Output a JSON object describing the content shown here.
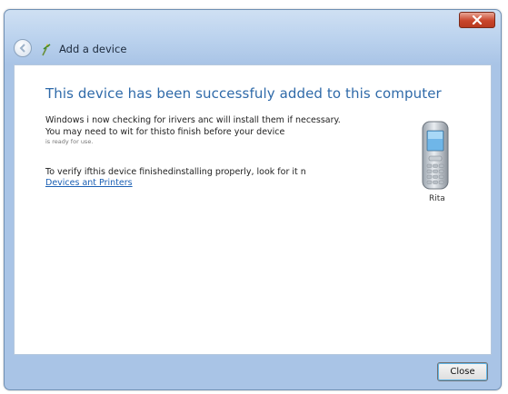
{
  "window": {
    "title": "Add a device"
  },
  "content": {
    "heading": "This device has been successfuly added to this computer",
    "message": "Windows i now checking for irivers anc will install them if necessary. You may need to wit for thisto finish before your device",
    "message_small": "is ready for use.",
    "verify_text": "To verify ifthis device finishedinstalling properly, look for it n",
    "link_text": "Devices ant Printers",
    "device_label": "Rita"
  },
  "footer": {
    "close_label": "Close"
  },
  "icons": {
    "window_close": "close-x-icon",
    "back": "back-arrow-icon",
    "wizard": "add-device-wizard-icon",
    "device": "mobile-phone-icon"
  }
}
